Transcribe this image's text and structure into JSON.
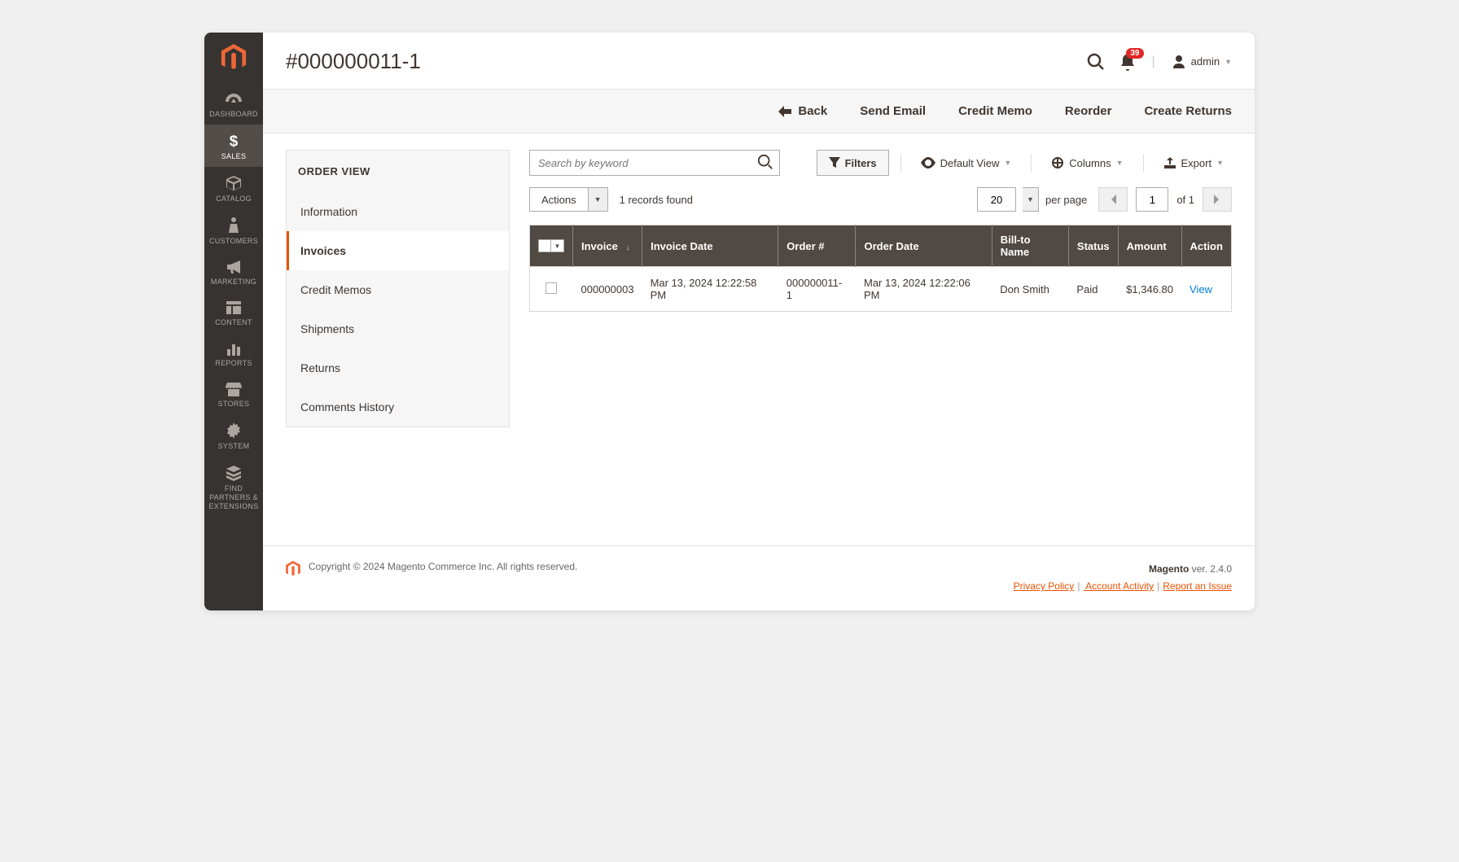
{
  "header": {
    "title": "#000000011-1",
    "notification_count": "39",
    "user_label": "admin"
  },
  "sidebar": {
    "items": [
      {
        "label": "DASHBOARD",
        "name": "dashboard"
      },
      {
        "label": "SALES",
        "name": "sales"
      },
      {
        "label": "CATALOG",
        "name": "catalog"
      },
      {
        "label": "CUSTOMERS",
        "name": "customers"
      },
      {
        "label": "MARKETING",
        "name": "marketing"
      },
      {
        "label": "CONTENT",
        "name": "content"
      },
      {
        "label": "REPORTS",
        "name": "reports"
      },
      {
        "label": "STORES",
        "name": "stores"
      },
      {
        "label": "SYSTEM",
        "name": "system"
      },
      {
        "label": "FIND PARTNERS & EXTENSIONS",
        "name": "partners"
      }
    ],
    "active_index": 1
  },
  "actions": {
    "back": "Back",
    "send_email": "Send Email",
    "credit_memo": "Credit Memo",
    "reorder": "Reorder",
    "create_returns": "Create Returns"
  },
  "order_view": {
    "title": "ORDER VIEW",
    "tabs": [
      "Information",
      "Invoices",
      "Credit Memos",
      "Shipments",
      "Returns",
      "Comments History"
    ],
    "active_index": 1
  },
  "grid": {
    "search_placeholder": "Search by keyword",
    "filters_label": "Filters",
    "default_view_label": "Default View",
    "columns_label": "Columns",
    "export_label": "Export",
    "actions_label": "Actions",
    "records_found": "1 records found",
    "per_page_value": "20",
    "per_page_label": "per page",
    "page_current": "1",
    "page_total_label": "of 1",
    "columns_headers": [
      "Invoice",
      "Invoice Date",
      "Order #",
      "Order Date",
      "Bill-to Name",
      "Status",
      "Amount",
      "Action"
    ],
    "rows": [
      {
        "invoice": "000000003",
        "invoice_date": "Mar 13, 2024 12:22:58 PM",
        "order_no": "000000011-1",
        "order_date": "Mar 13, 2024 12:22:06 PM",
        "bill_to": "Don Smith",
        "status": "Paid",
        "amount": "$1,346.80",
        "action": "View"
      }
    ]
  },
  "footer": {
    "copyright": "Copyright © 2024 Magento Commerce Inc. All rights reserved.",
    "brand": "Magento",
    "version": " ver. 2.4.0",
    "links": {
      "privacy": "Privacy Policy",
      "activity": " Account Activity",
      "report": "Report an Issue"
    }
  }
}
